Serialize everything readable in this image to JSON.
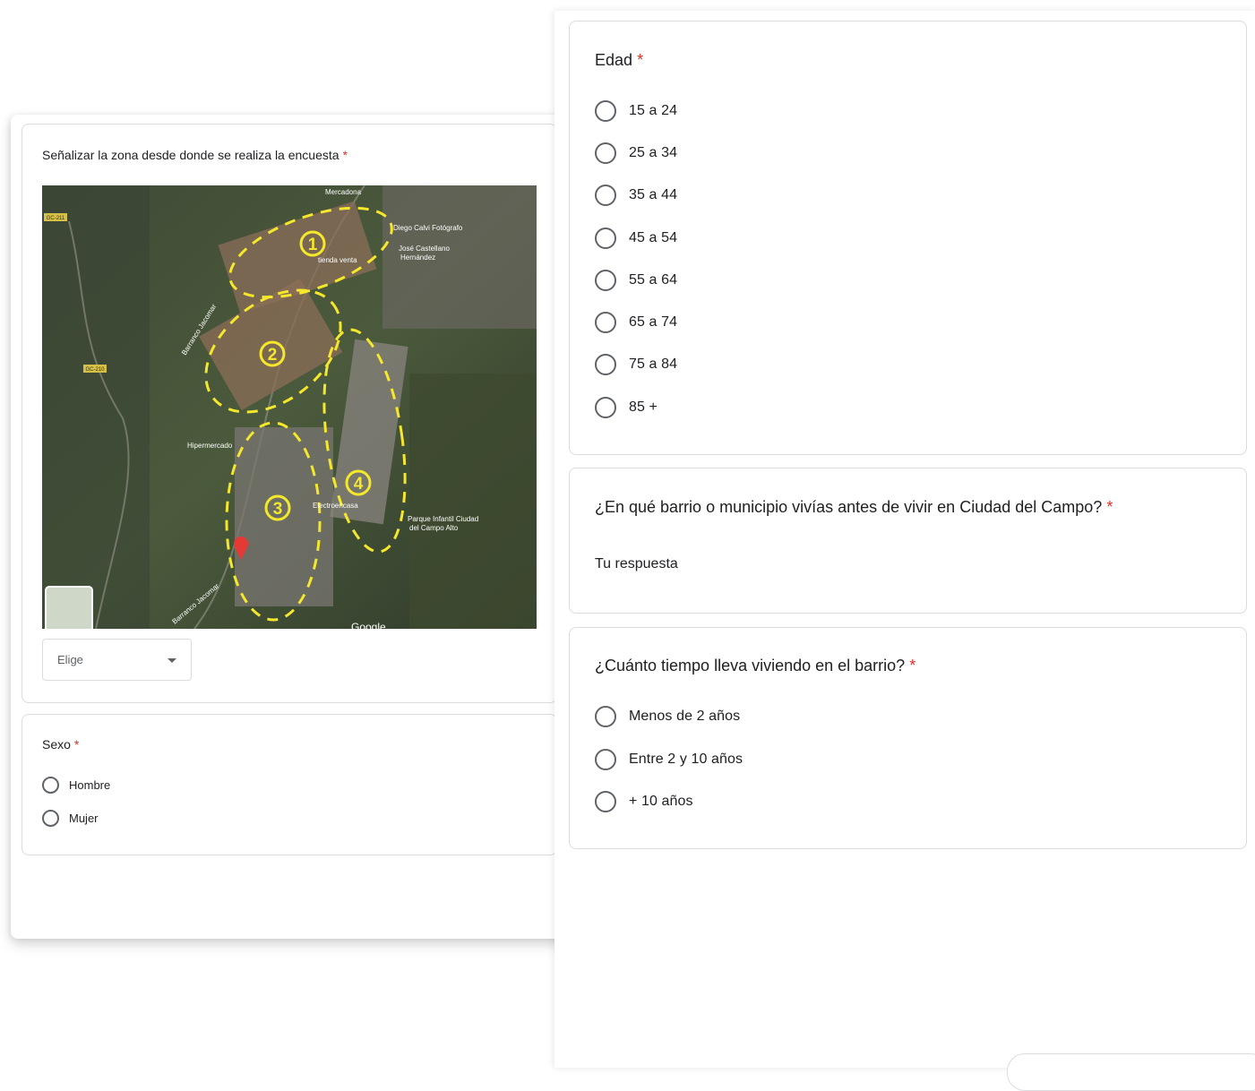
{
  "location_question": {
    "title": "Señalizar la zona desde donde se realiza la encuesta",
    "required_mark": "*",
    "map_labels": [
      "Mercadona",
      "Diego Calvi Fotógrafo",
      "José Castellano Hernández",
      "tienda venta",
      "Barranco Jacomar",
      "Hipermercado",
      "Electroencasa",
      "Parque Infantil Ciudad del Campo Alto",
      "GC-211",
      "GC-210",
      "Google"
    ],
    "zone_numbers": [
      "1",
      "2",
      "3",
      "4"
    ],
    "select_placeholder": "Elige"
  },
  "sexo_question": {
    "title": "Sexo",
    "required_mark": "*",
    "options": [
      "Hombre",
      "Mujer"
    ]
  },
  "edad_question": {
    "title": "Edad",
    "required_mark": "*",
    "options": [
      "15 a 24",
      "25 a 34",
      "35 a 44",
      "45 a 54",
      "55 a 64",
      "65 a 74",
      "75 a 84",
      "85 +"
    ]
  },
  "barrio_question": {
    "title": "¿En qué barrio o municipio vivías antes de vivir en Ciudad del Campo?",
    "required_mark": "*",
    "answer_placeholder": "Tu respuesta"
  },
  "tiempo_question": {
    "title": "¿Cuánto tiempo lleva viviendo en el barrio?",
    "required_mark": "*",
    "options": [
      "Menos de 2 años",
      "Entre 2 y 10 años",
      "+ 10 años"
    ]
  },
  "colors": {
    "required": "#d93025",
    "border": "#dadce0",
    "zone_outline": "#f5e72b"
  }
}
